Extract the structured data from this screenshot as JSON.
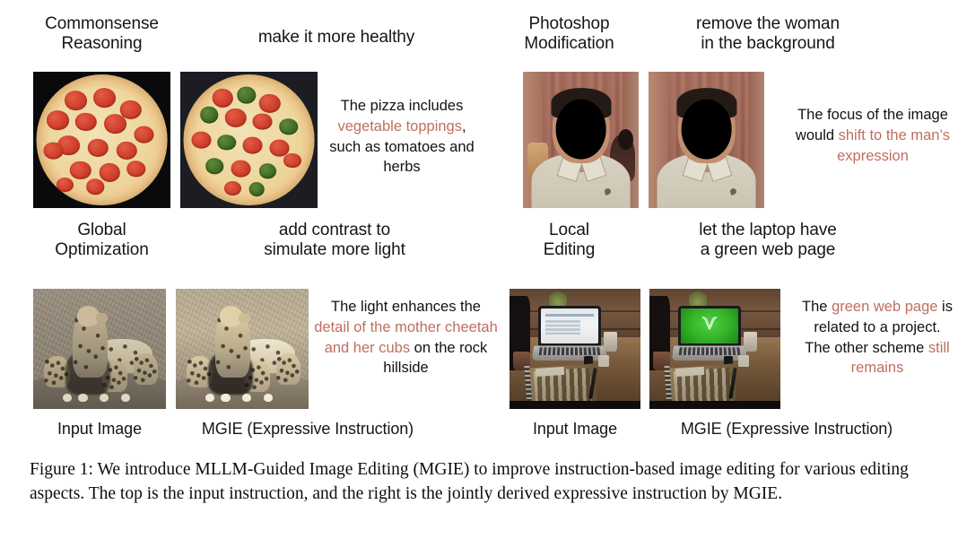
{
  "figure": {
    "caption": "Figure 1: We introduce MLLM-Guided Image Editing (MGIE) to improve instruction-based image editing for various editing aspects. The top is the input instruction, and the right is the jointly derived expressive instruction by MGIE."
  },
  "columns": {
    "input_label": "Input Image",
    "output_label": "MGIE (Expressive Instruction)"
  },
  "examples": [
    {
      "id": "commonsense-reasoning",
      "category": "Commonsense\nReasoning",
      "category_line1": "Commonsense",
      "category_line2": "Reasoning",
      "instruction": "make it more healthy",
      "expressive": {
        "segments": [
          {
            "text": "The pizza includes ",
            "highlight": false
          },
          {
            "text": "vegetable toppings",
            "highlight": true
          },
          {
            "text": ", such as tomatoes and herbs",
            "highlight": false
          }
        ],
        "plain": "The pizza includes vegetable toppings, such as tomatoes and herbs"
      },
      "input_image_name": "pepperoni-pizza-photo",
      "output_image_name": "vegetable-pizza-photo"
    },
    {
      "id": "photoshop-modification",
      "category_line1": "Photoshop",
      "category_line2": "Modification",
      "instruction": "remove the woman\nin the background",
      "instruction_line1": "remove the woman",
      "instruction_line2": "in the background",
      "expressive": {
        "segments": [
          {
            "text": "The focus of the image would ",
            "highlight": false
          },
          {
            "text": "shift to the man’s expression",
            "highlight": true
          }
        ],
        "plain": "The focus of the image would shift to the man’s expression"
      },
      "input_image_name": "man-portrait-with-woman-photo",
      "output_image_name": "man-portrait-woman-removed-photo"
    },
    {
      "id": "global-optimization",
      "category_line1": "Global",
      "category_line2": "Optimization",
      "instruction_line1": "add contrast to",
      "instruction_line2": "simulate more light",
      "expressive": {
        "segments": [
          {
            "text": "The light enhances the ",
            "highlight": false
          },
          {
            "text": "detail of the mother cheetah and her cubs",
            "highlight": true
          },
          {
            "text": " on the rock hillside",
            "highlight": false
          }
        ],
        "plain": "The light enhances the detail of the mother cheetah and her cubs on the rock hillside"
      },
      "input_image_name": "cheetah-family-photo",
      "output_image_name": "cheetah-family-brightened-photo"
    },
    {
      "id": "local-editing",
      "category_line1": "Local",
      "category_line2": "Editing",
      "instruction_line1": "let the laptop have",
      "instruction_line2": "a green web page",
      "expressive": {
        "segments": [
          {
            "text": "The ",
            "highlight": false
          },
          {
            "text": "green web page",
            "highlight": true
          },
          {
            "text": " is related to a project. The other scheme ",
            "highlight": false
          },
          {
            "text": "still remains",
            "highlight": true
          }
        ],
        "plain": "The green web page is related to a project. The other scheme still remains"
      },
      "input_image_name": "desk-laptop-photo",
      "output_image_name": "desk-laptop-green-screen-photo"
    }
  ],
  "colors": {
    "highlight": "#bf6f5d",
    "text": "#141414",
    "background": "#ffffff"
  }
}
